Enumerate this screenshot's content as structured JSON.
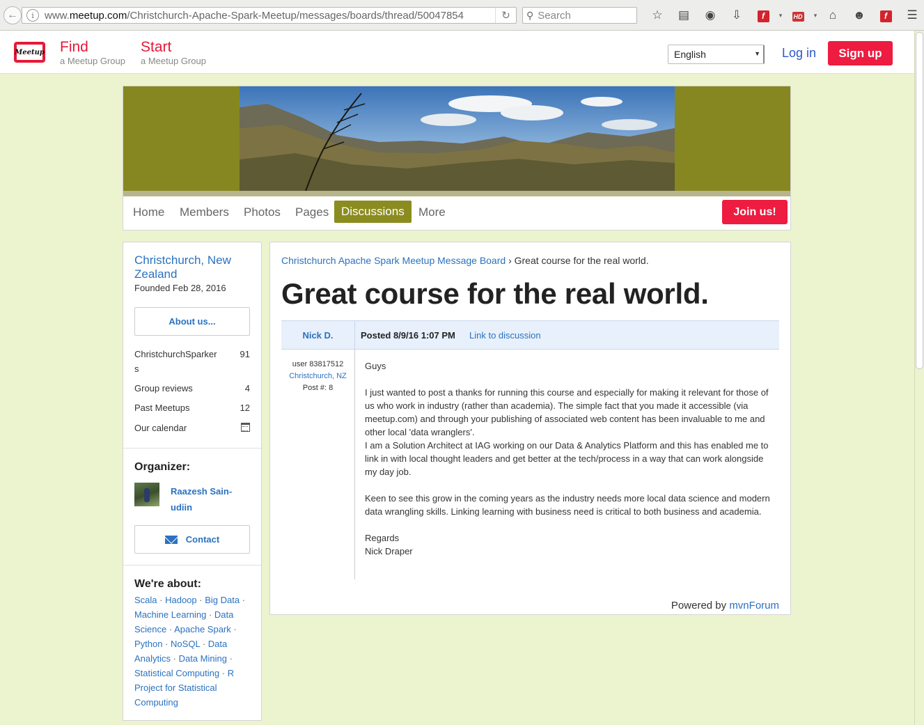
{
  "browser": {
    "url_prefix": "www.",
    "url_domain": "meetup.com",
    "url_path": "/Christchurch-Apache-Spark-Meetup/messages/boards/thread/50047854",
    "search_placeholder": "Search"
  },
  "header": {
    "logo_text": "Meetup",
    "find_label": "Find",
    "find_sub": "a Meetup Group",
    "start_label": "Start",
    "start_sub": "a Meetup Group",
    "language": "English",
    "login_label": "Log in",
    "signup_label": "Sign up"
  },
  "group_nav": {
    "tabs": [
      {
        "label": "Home"
      },
      {
        "label": "Members"
      },
      {
        "label": "Photos"
      },
      {
        "label": "Pages"
      },
      {
        "label": "Discussions"
      },
      {
        "label": "More"
      }
    ],
    "active_tab": "Discussions",
    "join_label": "Join us!"
  },
  "sidebar": {
    "city": "Christchurch, New Zealand",
    "founded": "Founded Feb 28, 2016",
    "about_label": "About us...",
    "stats": [
      {
        "label": "ChristchurchSparkers",
        "value": "91"
      },
      {
        "label": "Group reviews",
        "value": "4"
      },
      {
        "label": "Past Meetups",
        "value": "12"
      },
      {
        "label": "Our calendar",
        "value": ""
      }
    ],
    "organizer_title": "Organizer:",
    "organizer_name": "Raazesh Sain-udiin",
    "contact_label": "Contact",
    "about_title": "We're about:",
    "topics": [
      "Scala",
      "Hadoop",
      "Big Data",
      "Machine Learning",
      "Data Science",
      "Apache Spark",
      "Python",
      "NoSQL",
      "Data Analytics",
      "Data Mining",
      "Statistical Computing",
      "R Project for Statistical Computing"
    ]
  },
  "main": {
    "breadcrumb_board": "Christchurch Apache Spark Meetup Message Board",
    "breadcrumb_sep": "›",
    "breadcrumb_current": "Great course for the real world.",
    "title": "Great course for the real world.",
    "post": {
      "author": "Nick D.",
      "posted": "Posted 8/9/16 1:07 PM",
      "permalink_label": "Link to discussion",
      "user_id": "user 83817512",
      "location": "Christchurch, NZ",
      "post_number": "Post #: 8",
      "paragraphs": [
        "Guys",
        "I just wanted to post a thanks for running this course and especially for making it relevant for those of us who work in industry (rather than academia). The simple fact that you made it accessible (via meetup.com) and through your publishing of associated web content has been invaluable to me and other local 'data wranglers'.\nI am a Solution Architect at IAG working on our Data & Analytics Platform and this has enabled me to link in with local thought leaders and get better at the tech/process in a way that can work alongside my day job.",
        "Keen to see this grow in the coming years as the industry needs more local data science and modern data wrangling skills. Linking learning with business need is critical to both business and academia.",
        "Regards\nNick Draper"
      ]
    },
    "powered_prefix": "Powered by",
    "powered_link": "mvnForum"
  }
}
